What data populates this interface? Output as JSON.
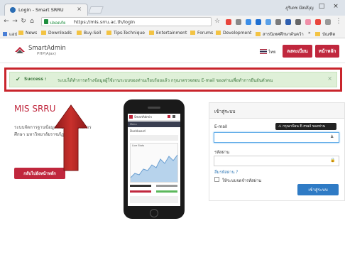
{
  "browser": {
    "tab_title": "Login - Smart SRRU",
    "tab_close": "×",
    "user_name": "ภูริเดช มีสมบุญ",
    "window_controls": {
      "minimize": "–",
      "maximize": "□",
      "close": "×"
    },
    "secure_label": "ปลอดภัย",
    "url": "https://mis.srru.ac.th/login",
    "bookmarks": [
      "แอป",
      "News",
      "Downloads",
      "Buy-Sell",
      "Tips-Technique",
      "Entertainment",
      "Forums",
      "Development",
      "สารนิเทศศึกษาค้นคว้า",
      "บัณฑิต"
    ],
    "bookmarks_more": "»",
    "icons": {
      "back": "arrow-left-icon",
      "forward": "arrow-right-icon",
      "reload": "reload-icon",
      "home": "home-icon",
      "bookmark": "star-icon"
    }
  },
  "header": {
    "logo_title": "SmartAdmin",
    "logo_sub": "PHP(Ajax)",
    "lang_label": "ไทย",
    "register_button": "ลงทะเบียน",
    "home_button": "หน้าหลัก",
    "colors": {
      "brand": "#c0273d"
    }
  },
  "alert": {
    "strong": "Success :",
    "message": "ระบบได้ทำการสร้างข้อมูลผู้ใช้งานระบบของท่านเรียบร้อยแล้ว กรุณาตรวจสอบ E-mail ของท่านเพื่อทำการยืนยันตัวตน",
    "close": "×",
    "colors": {
      "bg": "#dff0d8",
      "text": "#3c763d",
      "highlight": "#c9252c"
    }
  },
  "main": {
    "title": "MIS SRRU",
    "desc_line1": "ระบบจัดการฐานข้อมูลเพื่อการบริหารการ",
    "desc_line2": "ศึกษา มหาวิทยาลัยราชภัฏสุรินทร์",
    "back_button": "กลับไปยังหน้าหลัก"
  },
  "phone_screen": {
    "app_title": "SmartAdmin",
    "nav_label": "Menu",
    "page_title": "Dashboard",
    "chart_label": "Live Stats"
  },
  "login": {
    "title": "เข้าสู่ระบบ",
    "email_label": "E-mail",
    "email_value": "",
    "tooltip": "กรุณาป้อน E-mail ของท่าน",
    "password_label": "รหัสผ่าน",
    "password_value": "",
    "forgot_link": "ลืมรหัสผ่าน ?",
    "remember_label": "ให้ระบบจดจำรหัสผ่าน",
    "submit_button": "เข้าสู่ระบบ",
    "icons": {
      "email": "user-icon",
      "password": "lock-icon"
    },
    "colors": {
      "submit": "#2f7bc5",
      "link": "#337ab7"
    }
  }
}
